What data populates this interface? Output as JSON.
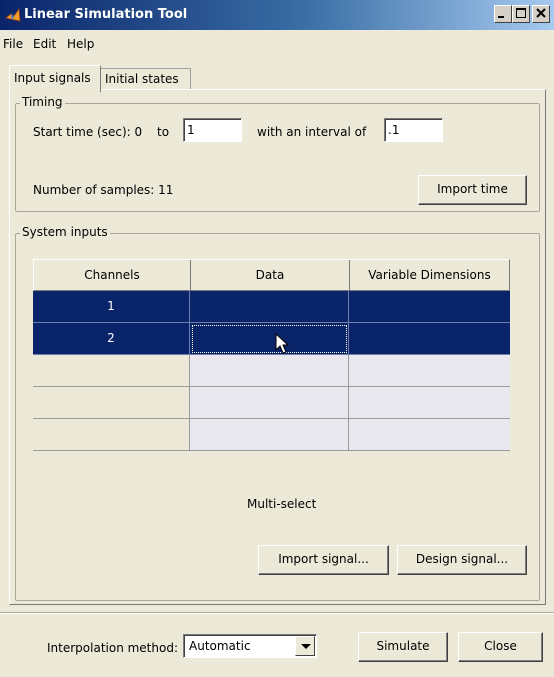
{
  "window": {
    "title": "Linear Simulation Tool",
    "accent_color": "#0a246a",
    "controls": [
      "minimize-icon",
      "maximize-icon",
      "close-icon"
    ]
  },
  "menu": {
    "items": [
      "File",
      "Edit",
      "Help"
    ]
  },
  "tabs": [
    {
      "label": "Input signals",
      "active": true
    },
    {
      "label": "Initial states",
      "active": false
    }
  ],
  "timing": {
    "legend": "Timing",
    "start_label": "Start time (sec): 0",
    "to_label": "to",
    "end_value": "1",
    "interval_label": "with an interval of",
    "interval_value": ".1",
    "samples_label": "Number of samples: 11",
    "import_time_label": "Import time"
  },
  "system_inputs": {
    "legend": "System inputs",
    "columns": [
      "Channels",
      "Data",
      "Variable Dimensions"
    ],
    "rows": [
      {
        "channel": "1",
        "data": "",
        "dims": "",
        "selected": true
      },
      {
        "channel": "2",
        "data": "",
        "dims": "",
        "selected": true
      },
      {
        "channel": "",
        "data": "",
        "dims": "",
        "selected": false
      },
      {
        "channel": "",
        "data": "",
        "dims": "",
        "selected": false
      },
      {
        "channel": "",
        "data": "",
        "dims": "",
        "selected": false
      }
    ],
    "status_text": "Multi-select",
    "import_signal_label": "Import signal...",
    "design_signal_label": "Design signal..."
  },
  "footer": {
    "interpolation_label": "Interpolation method:",
    "interpolation_value": "Automatic",
    "simulate_label": "Simulate",
    "close_label": "Close"
  }
}
